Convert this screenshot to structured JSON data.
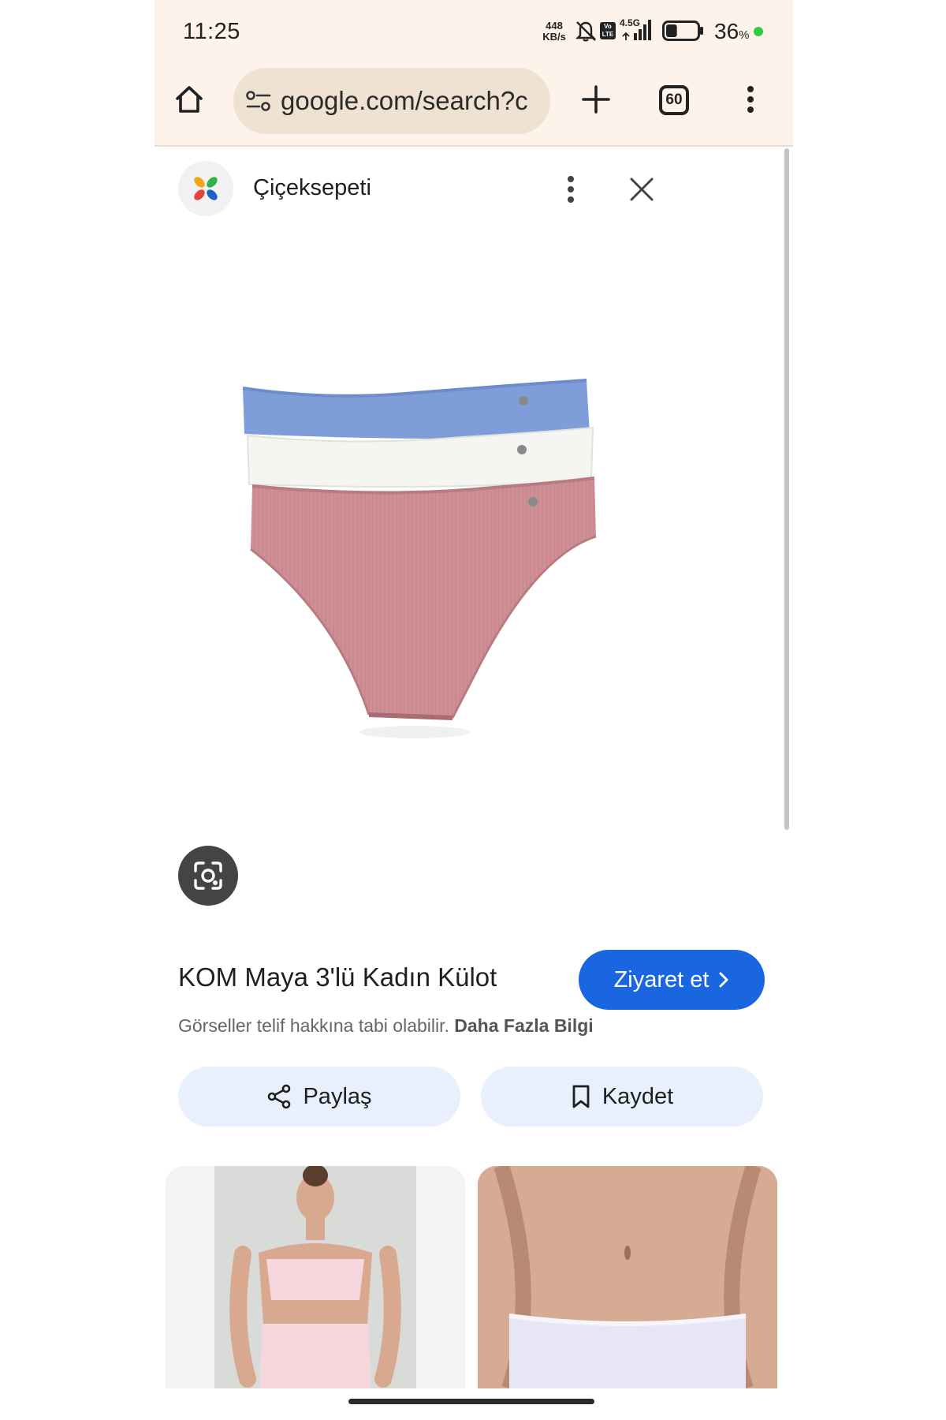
{
  "status_bar": {
    "time": "11:25",
    "net_speed_value": "448",
    "net_speed_unit": "KB/s",
    "network_label": "4.5G",
    "volte_label": "Vo LTE",
    "battery_percent": "36",
    "battery_unit": "%",
    "battery_level": 0.36
  },
  "browser": {
    "url": "google.com/search?c",
    "tab_count": "60"
  },
  "viewer": {
    "source_name": "Çiçeksepeti"
  },
  "product": {
    "title": "KOM Maya 3'lü Kadın Külot",
    "visit_label": "Ziyaret et",
    "copyright_text": "Görseller telif hakkına tabi olabilir.",
    "more_info_label": "Daha Fazla Bilgi",
    "share_label": "Paylaş",
    "save_label": "Kaydet"
  },
  "colors": {
    "accent_blue": "#1a66e0",
    "chip_background": "#e7f0fc",
    "browser_chrome": "#fdf3ea",
    "item_blue": "#7f9ed9",
    "item_white": "#f5f5f2",
    "item_pink": "#cf8f95"
  }
}
